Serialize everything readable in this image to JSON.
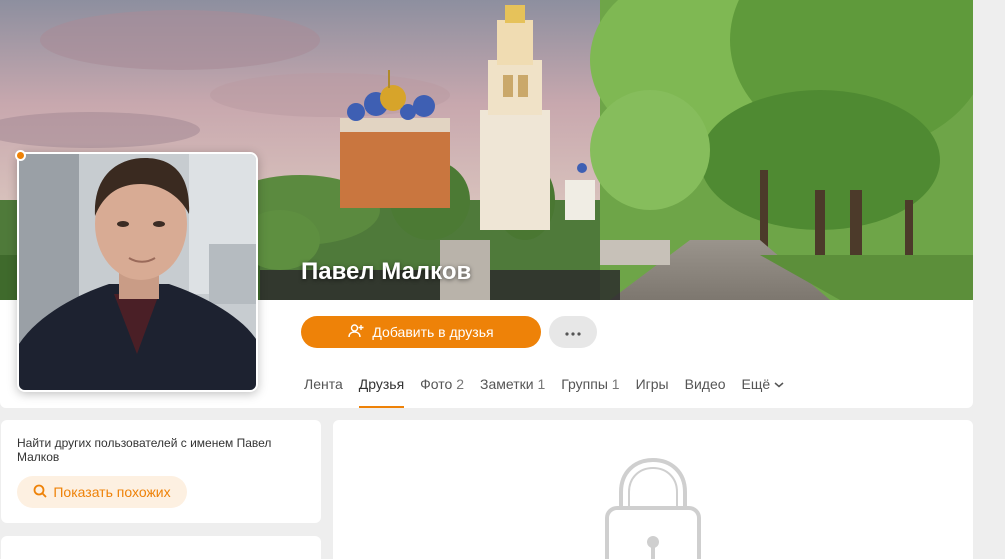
{
  "profile": {
    "name": "Павел Малков",
    "online": true
  },
  "actions": {
    "add_friend_label": "Добавить в друзья",
    "add_friend_icon": "add-user-icon",
    "more_icon": "more-dots-icon"
  },
  "tabs": [
    {
      "label": "Лента",
      "count": ""
    },
    {
      "label": "Друзья",
      "count": "",
      "active": true
    },
    {
      "label": "Фото",
      "count": "2"
    },
    {
      "label": "Заметки",
      "count": "1"
    },
    {
      "label": "Группы",
      "count": "1"
    },
    {
      "label": "Игры",
      "count": ""
    },
    {
      "label": "Видео",
      "count": ""
    },
    {
      "label": "Ещё",
      "count": ""
    }
  ],
  "sidebar": {
    "find_text": "Найти других пользователей с именем Павел Малков",
    "show_similar_label": "Показать похожих"
  },
  "colors": {
    "accent": "#ee8208",
    "accent_light": "#fdf0e1",
    "background": "#eeeeee"
  },
  "content": {
    "locked_icon": "lock-icon"
  }
}
